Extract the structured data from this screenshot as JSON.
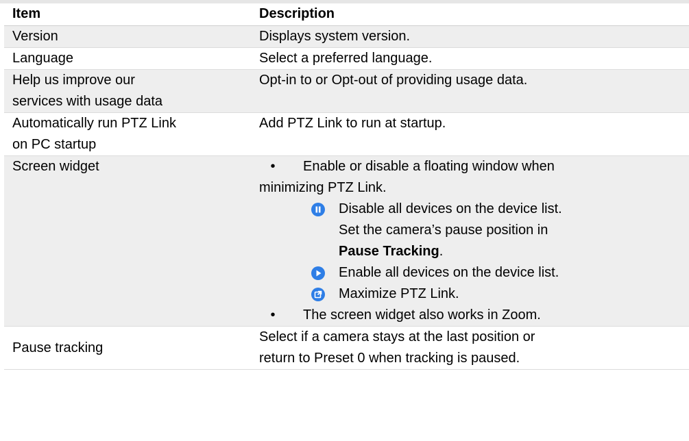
{
  "table": {
    "headers": {
      "item": "Item",
      "description": "Description"
    },
    "rows": [
      {
        "item": "Version",
        "description": "Displays system version."
      },
      {
        "item": "Language",
        "description": "Select a preferred language."
      },
      {
        "item_lines": [
          "Help us improve our",
          "services with usage data"
        ],
        "description": "Opt-in to or Opt-out of providing usage data."
      },
      {
        "item_lines": [
          "Automatically run PTZ Link",
          "on PC startup"
        ],
        "description": "Add PTZ Link to run at startup."
      },
      {
        "item": "Screen widget",
        "bullet1_lines": [
          "Enable or disable a floating window when",
          "minimizing PTZ Link."
        ],
        "pause_icon_line": "Disable all devices on the device list.",
        "pause_cont_line": "Set the camera’s pause position in",
        "pause_bold": "Pause Tracking",
        "pause_bold_suffix": ".",
        "play_icon_line": "Enable all devices on the device list.",
        "maximize_icon_line": "Maximize PTZ Link.",
        "bullet2": "The screen widget also works in Zoom.",
        "bullet_glyph": "•"
      },
      {
        "item": "Pause tracking",
        "description_lines": [
          "Select if a camera stays at the last position or",
          "return to Preset 0 when tracking is paused."
        ]
      }
    ]
  },
  "icons": {
    "pause": "pause-icon",
    "play": "play-icon",
    "maximize": "maximize-icon",
    "color": "#2e7ee6"
  }
}
